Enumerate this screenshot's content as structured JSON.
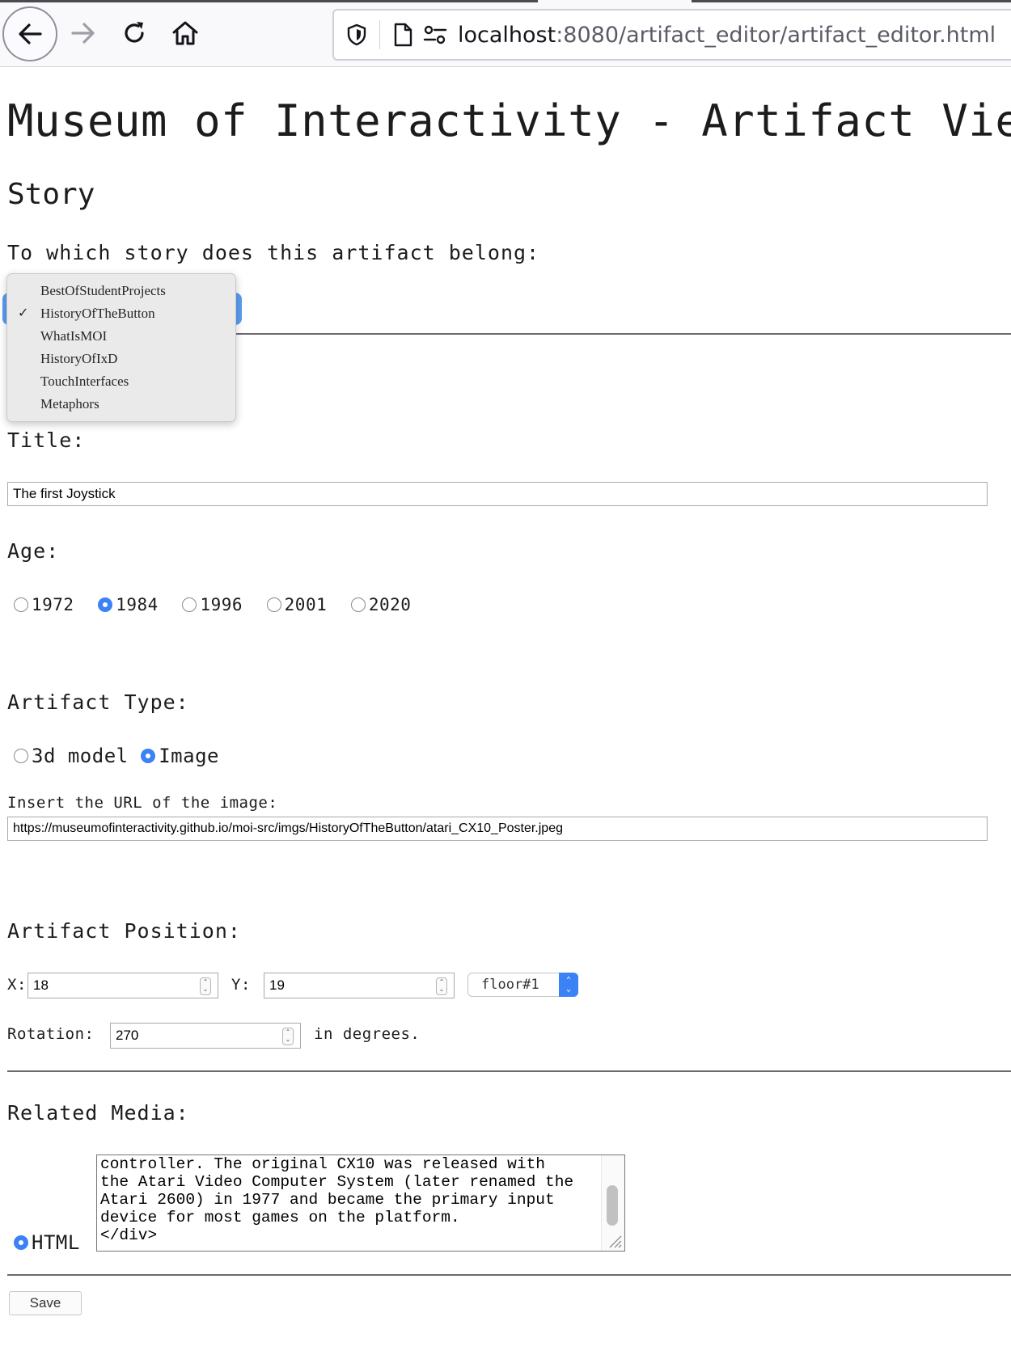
{
  "browser": {
    "url_host": "localhost",
    "url_rest": ":8080/artifact_editor/artifact_editor.html"
  },
  "page": {
    "title": "Museum of Interactivity - Artifact View"
  },
  "story": {
    "heading": "Story",
    "question": "To which story does this artifact belong:",
    "options": [
      "BestOfStudentProjects",
      "HistoryOfTheButton",
      "WhatIsMOI",
      "HistoryOfIxD",
      "TouchInterfaces",
      "Metaphors"
    ],
    "selected": "HistoryOfTheButton",
    "check_mark": "✓"
  },
  "title_field": {
    "label": "Title:",
    "value": "The first Joystick"
  },
  "age": {
    "label": "Age:",
    "options": [
      "1972",
      "1984",
      "1996",
      "2001",
      "2020"
    ],
    "selected": "1984"
  },
  "artifact_type": {
    "label": "Artifact Type:",
    "options": [
      "3d model",
      "Image"
    ],
    "selected": "Image",
    "url_prompt": "Insert the URL of the image:",
    "url_value": "https://museumofinteractivity.github.io/moi-src/imgs/HistoryOfTheButton/atari_CX10_Poster.jpeg"
  },
  "position": {
    "label": "Artifact Position:",
    "x_label": "X:",
    "x_value": "18",
    "y_label": "Y:",
    "y_value": "19",
    "floor": "floor#1",
    "rotation_label": "Rotation:",
    "rotation_value": "270",
    "rotation_unit": "in degrees."
  },
  "related_media": {
    "label": "Related Media:",
    "type_option": "HTML",
    "content": "controller. The original CX10 was released with\nthe Atari Video Computer System (later renamed the\nAtari 2600) in 1977 and became the primary input\ndevice for most games on the platform.\n</div>"
  },
  "actions": {
    "save_label": "Save"
  },
  "colors": {
    "accent": "#3b82f6",
    "rule": "#6b6b6b"
  }
}
